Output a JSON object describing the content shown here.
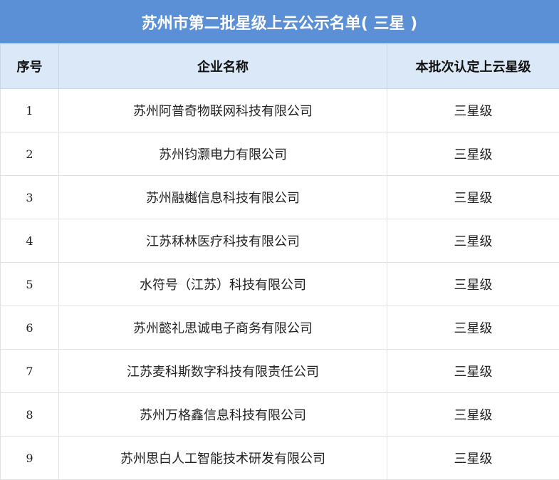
{
  "title": "苏州市第二批星级上云公示名单( 三星 )",
  "columns": {
    "num": "序号",
    "name": "企业名称",
    "level": "本批次认定上云星级"
  },
  "rows": [
    {
      "num": "1",
      "name": "苏州阿普奇物联网科技有限公司",
      "level": "三星级"
    },
    {
      "num": "2",
      "name": "苏州钧灏电力有限公司",
      "level": "三星级"
    },
    {
      "num": "3",
      "name": "苏州融樾信息科技有限公司",
      "level": "三星级"
    },
    {
      "num": "4",
      "name": "江苏秝林医疗科技有限公司",
      "level": "三星级"
    },
    {
      "num": "5",
      "name": "水符号（江苏）科技有限公司",
      "level": "三星级"
    },
    {
      "num": "6",
      "name": "苏州懿礼思诚电子商务有限公司",
      "level": "三星级"
    },
    {
      "num": "7",
      "name": "江苏麦科斯数字科技有限责任公司",
      "level": "三星级"
    },
    {
      "num": "8",
      "name": "苏州万格鑫信息科技有限公司",
      "level": "三星级"
    },
    {
      "num": "9",
      "name": "苏州思白人工智能技术研发有限公司",
      "level": "三星级"
    }
  ],
  "colors": {
    "title_bg": "#5b8fd6",
    "header_bg": "#dbe8f7"
  }
}
